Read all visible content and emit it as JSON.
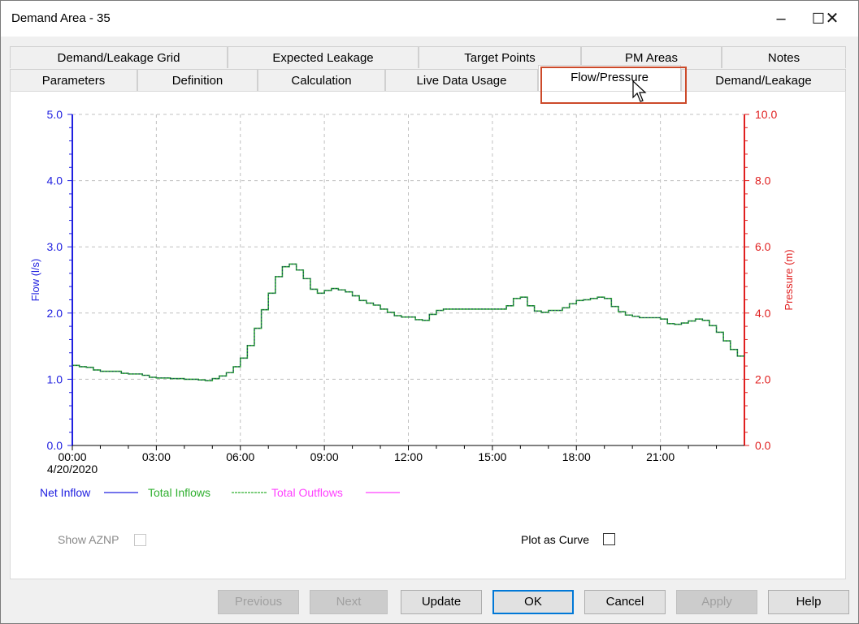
{
  "window": {
    "title": "Demand Area - 35",
    "minimize_icon": "minimize-icon",
    "maximize_icon": "maximize-icon",
    "close_icon": "close-icon"
  },
  "tabs_row1": [
    {
      "label": "Demand/Leakage Grid"
    },
    {
      "label": "Expected Leakage"
    },
    {
      "label": "Target Points"
    },
    {
      "label": "PM Areas"
    },
    {
      "label": "Notes"
    }
  ],
  "tabs_row2": [
    {
      "label": "Parameters"
    },
    {
      "label": "Definition"
    },
    {
      "label": "Calculation"
    },
    {
      "label": "Live Data Usage"
    },
    {
      "label": "Flow/Pressure",
      "selected": true
    },
    {
      "label": "Demand/Leakage"
    }
  ],
  "highlight_color": "#cc4a2a",
  "chart_data": {
    "type": "line",
    "step": true,
    "grid": true,
    "xlabel": "",
    "x_date": "4/20/2020",
    "x_ticks": [
      "00:00",
      "03:00",
      "06:00",
      "09:00",
      "12:00",
      "15:00",
      "18:00",
      "21:00"
    ],
    "x_range": [
      "00:00",
      "24:00"
    ],
    "sample_interval": "00:15",
    "ylabel_left": "Flow (l/s)",
    "ylim_left": [
      0,
      5
    ],
    "yticks_left": [
      "0.0",
      "1.0",
      "2.0",
      "3.0",
      "4.0",
      "5.0"
    ],
    "ylabel_right": "Pressure (m)",
    "ylim_right": [
      0,
      10
    ],
    "yticks_right": [
      "0.0",
      "2.0",
      "4.0",
      "6.0",
      "8.0",
      "10.0"
    ],
    "left_axis_color": "#2020e0",
    "right_axis_color": "#e02020",
    "legend_placement": "bottom-left",
    "legend": [
      {
        "name": "Net Inflow",
        "color": "#2020e0",
        "style": "solid"
      },
      {
        "name": "Total Inflows",
        "color": "#30b030",
        "style": "dashed"
      },
      {
        "name": "Total Outflows",
        "color": "#ff40ff",
        "style": "solid"
      }
    ],
    "series": [
      {
        "name": "Net Inflow",
        "values": [
          1.21,
          1.19,
          1.18,
          1.14,
          1.12,
          1.12,
          1.12,
          1.09,
          1.08,
          1.08,
          1.06,
          1.03,
          1.02,
          1.02,
          1.01,
          1.01,
          1.0,
          1.0,
          0.99,
          0.98,
          1.01,
          1.05,
          1.1,
          1.19,
          1.32,
          1.51,
          1.77,
          2.05,
          2.3,
          2.55,
          2.7,
          2.74,
          2.65,
          2.52,
          2.36,
          2.3,
          2.34,
          2.37,
          2.35,
          2.32,
          2.26,
          2.19,
          2.15,
          2.12,
          2.06,
          2.01,
          1.96,
          1.94,
          1.94,
          1.9,
          1.89,
          1.98,
          2.04,
          2.06,
          2.06,
          2.06,
          2.06,
          2.06,
          2.06,
          2.06,
          2.06,
          2.06,
          2.11,
          2.22,
          2.24,
          2.11,
          2.03,
          2.01,
          2.04,
          2.04,
          2.08,
          2.14,
          2.19,
          2.2,
          2.22,
          2.24,
          2.22,
          2.1,
          2.02,
          1.97,
          1.95,
          1.93,
          1.93,
          1.93,
          1.91,
          1.84,
          1.83,
          1.85,
          1.88,
          1.91,
          1.89,
          1.81,
          1.71,
          1.58,
          1.45,
          1.35
        ]
      }
    ]
  },
  "options": {
    "show_aznp_label": "Show AZNP",
    "show_aznp_checked": false,
    "plot_as_curve_label": "Plot as Curve",
    "plot_as_curve_checked": false
  },
  "buttons": {
    "previous": "Previous",
    "next": "Next",
    "update": "Update",
    "ok": "OK",
    "cancel": "Cancel",
    "apply": "Apply",
    "help": "Help"
  }
}
